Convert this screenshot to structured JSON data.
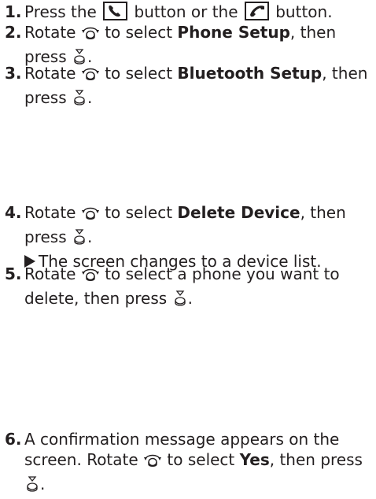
{
  "steps": [
    {
      "num": "1.",
      "text_a": "Press the",
      "text_b": "button or the",
      "text_c": "button."
    },
    {
      "num": "2.",
      "text_a": "Rotate",
      "text_b": "to select",
      "bold": "Phone Setup",
      "text_c": ", then",
      "cont_text": "press"
    },
    {
      "num": "3.",
      "text_a": "Rotate",
      "text_b": "to select",
      "bold": "Bluetooth Setup",
      "text_c": ", then",
      "cont_text": "press"
    },
    {
      "num": "4.",
      "text_a": "Rotate",
      "text_b": "to select",
      "bold": "Delete Device",
      "text_c": ", then",
      "cont_text": "press",
      "result": "The screen changes to a device list."
    },
    {
      "num": "5.",
      "text_a": "Rotate",
      "text_b": "to select a phone you want to",
      "cont_text": "delete, then press"
    },
    {
      "num": "6.",
      "line1": "A confirmation message appears on the",
      "line2_a": "screen. Rotate",
      "line2_b": "to select",
      "bold": "Yes",
      "line2_c": ", then press"
    }
  ],
  "icons": {
    "pickup": "phone-pickup-icon",
    "hangup": "phone-hangup-icon",
    "knob": "rotate-knob-icon",
    "press": "press-knob-icon"
  },
  "colors": {
    "text": "#231f20",
    "background": "#ffffff"
  }
}
